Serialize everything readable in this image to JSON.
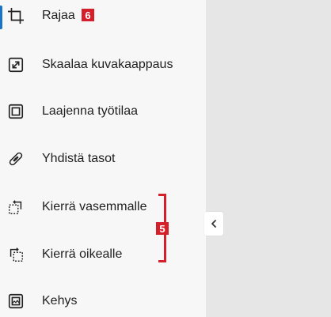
{
  "menu": {
    "items": [
      {
        "label": "Rajaa",
        "icon": "crop-icon",
        "active": true
      },
      {
        "label": "Skaalaa kuvakaappaus",
        "icon": "resize-icon"
      },
      {
        "label": "Laajenna työtilaa",
        "icon": "expand-canvas-icon"
      },
      {
        "label": "Yhdistä tasot",
        "icon": "merge-layers-icon"
      },
      {
        "label": "Kierrä vasemmalle",
        "icon": "rotate-left-icon"
      },
      {
        "label": "Kierrä oikealle",
        "icon": "rotate-right-icon"
      },
      {
        "label": "Kehys",
        "icon": "frame-icon"
      }
    ]
  },
  "annotations": {
    "crop_badge": "6",
    "rotate_badge": "5"
  },
  "colors": {
    "accent": "#1a73c8",
    "annotation_red": "#d4202b",
    "sidebar_bg": "#f7f7f8",
    "canvas_bg": "#e6e6e6"
  },
  "collapse_button": {
    "icon": "chevron-left-icon"
  }
}
